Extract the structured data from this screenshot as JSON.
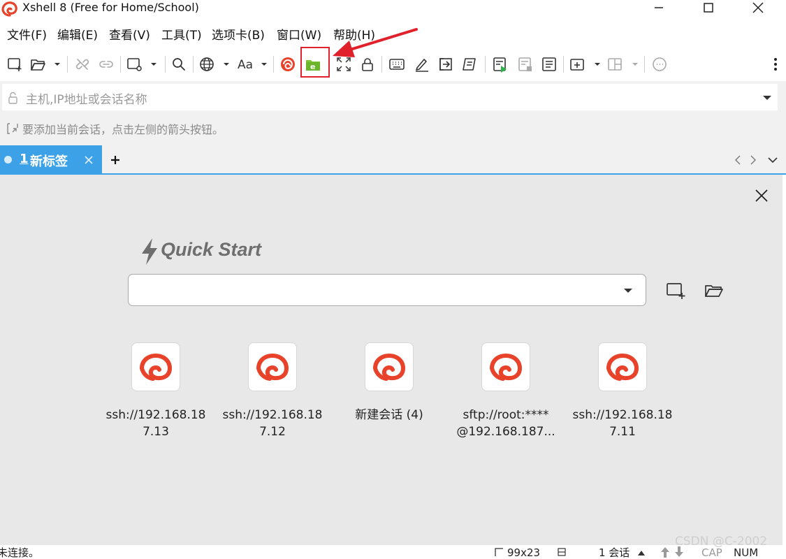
{
  "window": {
    "title": "Xshell 8 (Free for Home/School)"
  },
  "menu": [
    "文件(F)",
    "编辑(E)",
    "查看(V)",
    "工具(T)",
    "选项卡(B)",
    "窗口(W)",
    "帮助(H)"
  ],
  "address": {
    "placeholder": "主机,IP地址或会话名称"
  },
  "hint": "要添加当前会话，点击左侧的箭头按钮。",
  "tab": {
    "number": "1",
    "label": "新标签"
  },
  "quick_start": {
    "title": "Quick Start",
    "sessions": [
      {
        "line1": "ssh://192.168.18",
        "line2": "7.13"
      },
      {
        "line1": "ssh://192.168.18",
        "line2": "7.12"
      },
      {
        "line1": "新建会话 (4)",
        "line2": ""
      },
      {
        "line1": "sftp://root:****",
        "line2": "@192.168.187..."
      },
      {
        "line1": "ssh://192.168.18",
        "line2": "7.11"
      }
    ]
  },
  "status": {
    "connection": "未连接。",
    "size": "99x23",
    "sessions": "1 会话",
    "cap": "CAP",
    "num": "NUM"
  },
  "watermark": "CSDN @C-2002",
  "colors": {
    "accent": "#3ca1e6",
    "brand": "#e8432a",
    "highlight": "#e0212c"
  }
}
